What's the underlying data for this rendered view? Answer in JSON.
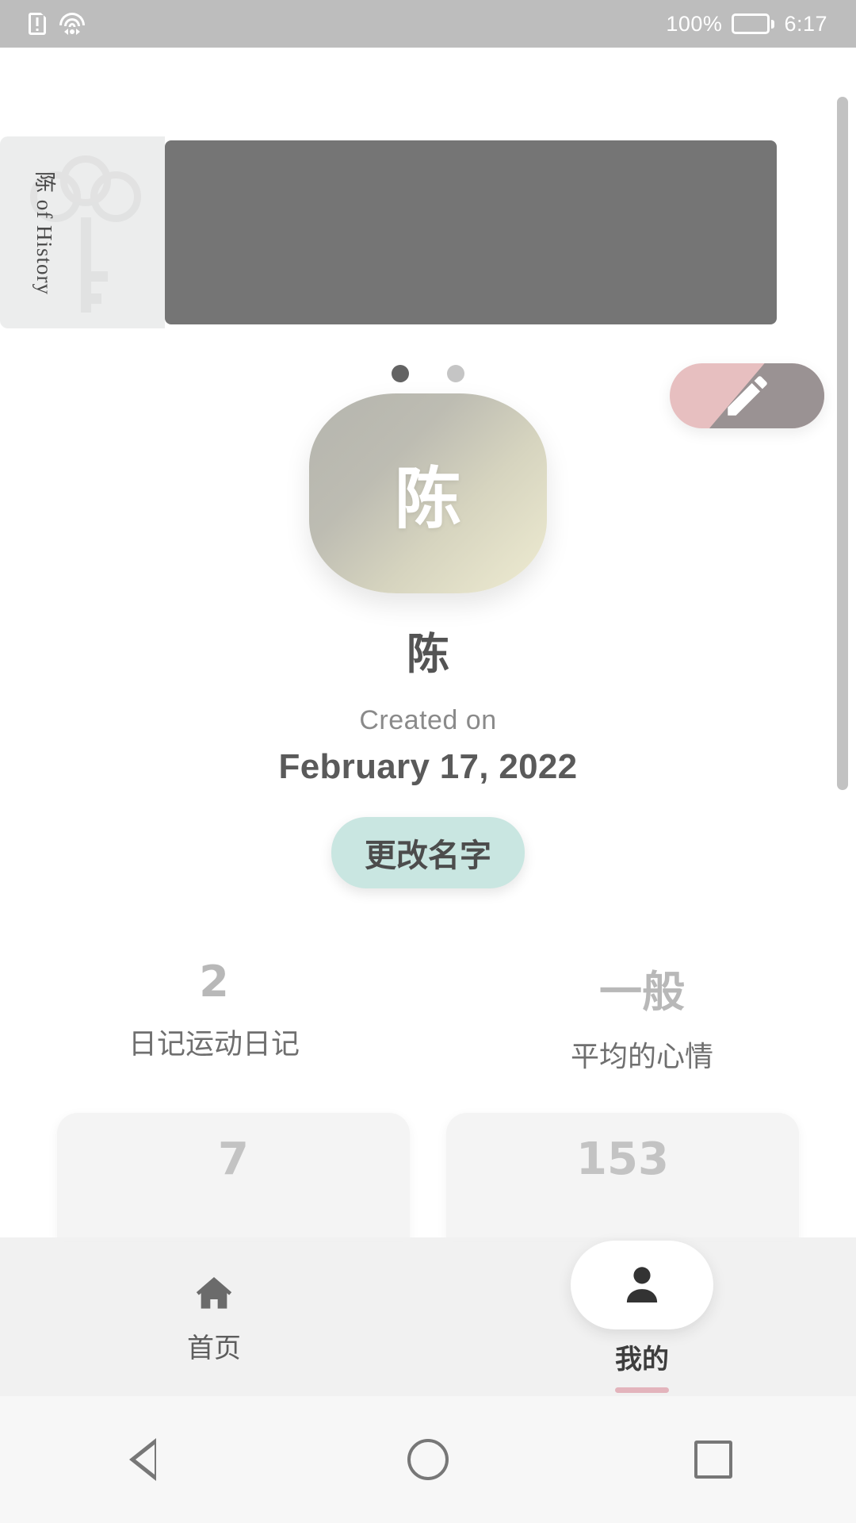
{
  "status_bar": {
    "icons": [
      "document-alert-icon",
      "wifi-icon"
    ],
    "battery_percent": "100%",
    "time": "6:17"
  },
  "banner": {
    "vertical_text": "陈 of History",
    "art_icon": "key-icon",
    "overlay_color": "#757575",
    "card_color": "#eceded"
  },
  "carousel": {
    "dots": [
      {
        "state": "active"
      },
      {
        "state": "idle"
      }
    ]
  },
  "edit_fab": {
    "icon": "pencil-icon",
    "accent_color": "#e7bfc0",
    "overlay_color": "#9a9293"
  },
  "profile": {
    "avatar_letter": "陈",
    "name": "陈",
    "created_label": "Created on",
    "created_date": "February 17, 2022",
    "rename_button": "更改名字",
    "rename_button_color": "#c9e6e1"
  },
  "stats": [
    {
      "value": "2",
      "label": "日记运动日记"
    },
    {
      "value": "一般",
      "label": "平均的心情"
    }
  ],
  "info_cards": [
    {
      "value": "7",
      "label": ""
    },
    {
      "value": "153",
      "label": ""
    }
  ],
  "bottom_nav": {
    "items": [
      {
        "label": "首页",
        "icon": "home-icon",
        "active": false
      },
      {
        "label": "我的",
        "icon": "person-icon",
        "active": true
      }
    ],
    "active_indicator_color": "#e3b4bc"
  },
  "android_nav": {
    "back": "back-triangle-icon",
    "home": "home-circle-icon",
    "recents": "recents-square-icon"
  }
}
